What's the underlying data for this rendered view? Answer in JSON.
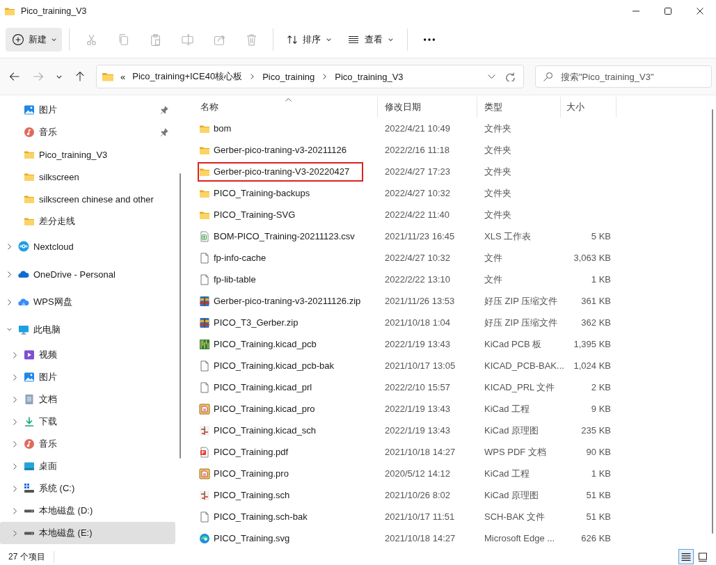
{
  "window": {
    "title": "Pico_training_V3"
  },
  "toolbar": {
    "new_button": "新建",
    "actions": [
      {
        "kind": "cut",
        "disabled": true
      },
      {
        "kind": "copy",
        "disabled": true
      },
      {
        "kind": "paste",
        "disabled": true
      },
      {
        "kind": "rename",
        "disabled": true
      },
      {
        "kind": "share",
        "disabled": true
      },
      {
        "kind": "delete",
        "disabled": true
      }
    ],
    "sort_button": "排序",
    "view_button": "查看"
  },
  "address_bar": {
    "overflow": "«",
    "crumbs": [
      "Pico_training+ICE40核心板",
      "Pico_training",
      "Pico_training_V3"
    ]
  },
  "search": {
    "placeholder": "搜索\"Pico_training_V3\""
  },
  "sidebar": {
    "items": [
      {
        "label": "图片",
        "kind": "pictures",
        "pinned": true,
        "selected": false
      },
      {
        "label": "音乐",
        "kind": "music",
        "pinned": true,
        "selected": false
      },
      {
        "label": "Pico_training_V3",
        "kind": "folder",
        "pinned": false,
        "selected": false
      },
      {
        "label": "silkscreen",
        "kind": "folder",
        "pinned": false,
        "selected": false
      },
      {
        "label": "silkscreen chinese and other",
        "kind": "folder",
        "pinned": false,
        "selected": false
      },
      {
        "label": "差分走线",
        "kind": "folder",
        "pinned": false,
        "selected": false
      },
      {
        "label": "Nextcloud",
        "kind": "nextcloud",
        "expandable": true,
        "expanded": false,
        "selected": false
      },
      {
        "label": "OneDrive - Personal",
        "kind": "onedrive",
        "expandable": true,
        "expanded": false,
        "selected": false
      },
      {
        "label": "WPS网盘",
        "kind": "wps",
        "expandable": true,
        "expanded": false,
        "selected": false
      },
      {
        "label": "此电脑",
        "kind": "pc",
        "expandable": true,
        "expanded": true,
        "selected": false,
        "children": [
          {
            "label": "视频",
            "kind": "video",
            "expandable": true,
            "expanded": false,
            "selected": false
          },
          {
            "label": "图片",
            "kind": "pictures",
            "expandable": true,
            "expanded": false,
            "selected": false
          },
          {
            "label": "文档",
            "kind": "docs",
            "expandable": true,
            "expanded": false,
            "selected": false
          },
          {
            "label": "下载",
            "kind": "downloads",
            "expandable": true,
            "expanded": false,
            "selected": false
          },
          {
            "label": "音乐",
            "kind": "music",
            "expandable": true,
            "expanded": false,
            "selected": false
          },
          {
            "label": "桌面",
            "kind": "desktop",
            "expandable": true,
            "expanded": false,
            "selected": false
          },
          {
            "label": "系统 (C:)",
            "kind": "system-drive",
            "expandable": true,
            "expanded": false,
            "selected": false
          },
          {
            "label": "本地磁盘 (D:)",
            "kind": "drive",
            "expandable": true,
            "expanded": false,
            "selected": false
          },
          {
            "label": "本地磁盘 (E:)",
            "kind": "drive",
            "expandable": true,
            "expanded": false,
            "selected": true
          }
        ]
      }
    ]
  },
  "table": {
    "columns": [
      {
        "label": "名称",
        "sorted": true
      },
      {
        "label": "修改日期",
        "sorted": false
      },
      {
        "label": "类型",
        "sorted": false
      },
      {
        "label": "大小",
        "sorted": false
      }
    ],
    "rows": [
      {
        "kind": "folder",
        "name": "bom",
        "date": "2022/4/21 10:49",
        "type": "文件夹",
        "highlighted": false
      },
      {
        "kind": "folder",
        "name": "Gerber-pico-traning-v3-20211126",
        "date": "2022/2/16 11:18",
        "type": "文件夹",
        "highlighted": false
      },
      {
        "kind": "folder",
        "name": "Gerber-pico-traning-V3-20220427",
        "date": "2022/4/27 17:23",
        "type": "文件夹",
        "highlighted": true
      },
      {
        "kind": "folder",
        "name": "PICO_Training-backups",
        "date": "2022/4/27 10:32",
        "type": "文件夹",
        "highlighted": false
      },
      {
        "kind": "folder",
        "name": "PICO_Training-SVG",
        "date": "2022/4/22 11:40",
        "type": "文件夹",
        "highlighted": false
      },
      {
        "kind": "csv",
        "name": "BOM-PICO_Training-20211123.csv",
        "date": "2021/11/23 16:45",
        "type": "XLS 工作表",
        "size": "5 KB",
        "highlighted": false
      },
      {
        "kind": "blank",
        "name": "fp-info-cache",
        "date": "2022/4/27 10:32",
        "type": "文件",
        "size": "3,063 KB",
        "highlighted": false
      },
      {
        "kind": "blank",
        "name": "fp-lib-table",
        "date": "2022/2/22 13:10",
        "type": "文件",
        "size": "1 KB",
        "highlighted": false
      },
      {
        "kind": "zip",
        "name": "Gerber-pico-traning-v3-20211126.zip",
        "date": "2021/11/26 13:53",
        "type": "好压 ZIP 压缩文件",
        "size": "361 KB",
        "highlighted": false
      },
      {
        "kind": "zip",
        "name": "PICO_T3_Gerber.zip",
        "date": "2021/10/18 1:04",
        "type": "好压 ZIP 压缩文件",
        "size": "362 KB",
        "highlighted": false
      },
      {
        "kind": "pcb",
        "name": "PICO_Training.kicad_pcb",
        "date": "2022/1/19 13:43",
        "type": "KiCad PCB 板",
        "size": "1,395 KB",
        "highlighted": false
      },
      {
        "kind": "blank",
        "name": "PICO_Training.kicad_pcb-bak",
        "date": "2021/10/17 13:05",
        "type": "KICAD_PCB-BAK...",
        "size": "1,024 KB",
        "highlighted": false
      },
      {
        "kind": "blank",
        "name": "PICO_Training.kicad_prl",
        "date": "2022/2/10 15:57",
        "type": "KICAD_PRL 文件",
        "size": "2 KB",
        "highlighted": false
      },
      {
        "kind": "kicad-pro",
        "name": "PICO_Training.kicad_pro",
        "date": "2022/1/19 13:43",
        "type": "KiCad 工程",
        "size": "9 KB",
        "highlighted": false
      },
      {
        "kind": "kicad-sch",
        "name": "PICO_Training.kicad_sch",
        "date": "2022/1/19 13:43",
        "type": "KiCad 原理图",
        "size": "235 KB",
        "highlighted": false
      },
      {
        "kind": "pdf",
        "name": "PICO_Training.pdf",
        "date": "2021/10/18 14:27",
        "type": "WPS PDF 文档",
        "size": "90 KB",
        "highlighted": false
      },
      {
        "kind": "kicad-pro",
        "name": "PICO_Training.pro",
        "date": "2020/5/12 14:12",
        "type": "KiCad 工程",
        "size": "1 KB",
        "highlighted": false
      },
      {
        "kind": "kicad-sch",
        "name": "PICO_Training.sch",
        "date": "2021/10/26 8:02",
        "type": "KiCad 原理图",
        "size": "51 KB",
        "highlighted": false
      },
      {
        "kind": "blank",
        "name": "PICO_Training.sch-bak",
        "date": "2021/10/17 11:51",
        "type": "SCH-BAK 文件",
        "size": "51 KB",
        "highlighted": false
      },
      {
        "kind": "edge",
        "name": "PICO_Training.svg",
        "date": "2021/10/18 14:27",
        "type": "Microsoft Edge ...",
        "size": "626 KB",
        "highlighted": false
      }
    ]
  },
  "status_bar": {
    "count": "27 个项目",
    "views": [
      {
        "kind": "details",
        "selected": true
      },
      {
        "kind": "tiles",
        "selected": false
      }
    ]
  }
}
